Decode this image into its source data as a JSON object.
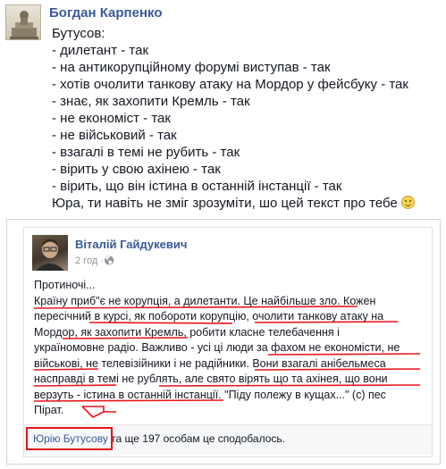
{
  "post": {
    "author": "Богдан Карпенко",
    "lines": [
      "Бутусов:",
      "- дилетант - так",
      "- на антикорупційному форумі виступав - так",
      "- хотів очолити танкову атаку на Мордор у фейсбуку - так",
      "- знає, як захопити Кремль - так",
      "- не економіст - так",
      "- не військовий - так",
      "- взагалі в темі не рубить - так",
      "- вірить у свою ахінею - так",
      "- вірить, що він істина в останній інстанції - так",
      "Юра, ти навіть не зміг зрозуміти, шо цей текст про тебе"
    ]
  },
  "shared": {
    "author": "Віталій Гайдукевич",
    "time": "2 год",
    "lines": [
      "Протиночі...",
      "Країну приб\"є не корупція, а дилетанти. Це найбільше зло. Кожен",
      "пересічний в курсі, як побороти корупцію, очолити танкову атаку на",
      "Мордор, як захопити Кремль, робити класне телебачення і",
      "україномовне радіо. Важливо - усі ці люди за фахом не економісти, не",
      "військові, не телевізійники і не радійники. Вони взагалі анібельмеса",
      "насправді в темі не рублять, але свято вірять що та ахінея, що вони",
      "верзуть - істина в останній інстанції. \"Піду полежу в кущах...\" (с) пес",
      "Пірат."
    ],
    "likes": {
      "name": "Юрію Бутусову",
      "rest": " та ще 197 особам це сподобалось."
    }
  },
  "icons": [
    "globe-icon",
    "smile-emoji-icon",
    "chevron-down-icon"
  ],
  "colors": {
    "link": "#3b5998",
    "annotation": "#e8141c",
    "meta": "#90949c"
  }
}
